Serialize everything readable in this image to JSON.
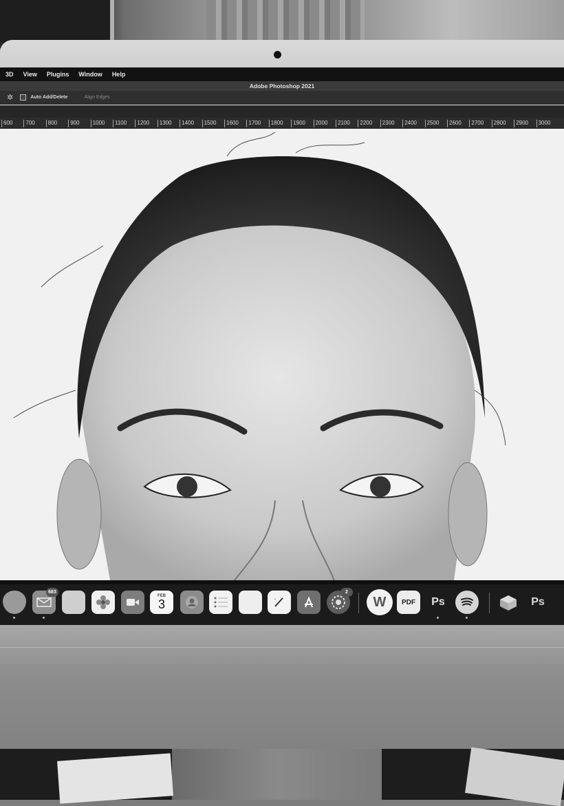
{
  "menubar": {
    "items": [
      "3D",
      "View",
      "Plugins",
      "Window",
      "Help"
    ]
  },
  "app": {
    "title": "Adobe Photoshop 2021"
  },
  "options_bar": {
    "auto_add_delete": "Auto Add/Delete",
    "align_edges": "Align Edges"
  },
  "ruler": {
    "ticks": [
      "600",
      "700",
      "800",
      "900",
      "1000",
      "1100",
      "1200",
      "1300",
      "1400",
      "1500",
      "1600",
      "1700",
      "1800",
      "1900",
      "2000",
      "2100",
      "2200",
      "2300",
      "2400",
      "2500",
      "2600",
      "2700",
      "2800",
      "2900",
      "3000"
    ]
  },
  "canvas": {
    "content": "pencil-portrait-drawing"
  },
  "dock": {
    "mail_badge": "683",
    "calendar_month": "FEB",
    "calendar_day": "3",
    "settings_badge": "2",
    "writer_label": "W",
    "pdf_label": "PDF",
    "ps_label": "Ps",
    "ps2_label": "Ps"
  },
  "colors": {
    "menubar": "#121212",
    "titlebar": "#3b3b3b",
    "dock": "#1b1b1b",
    "canvas": "#f1f1f1"
  }
}
